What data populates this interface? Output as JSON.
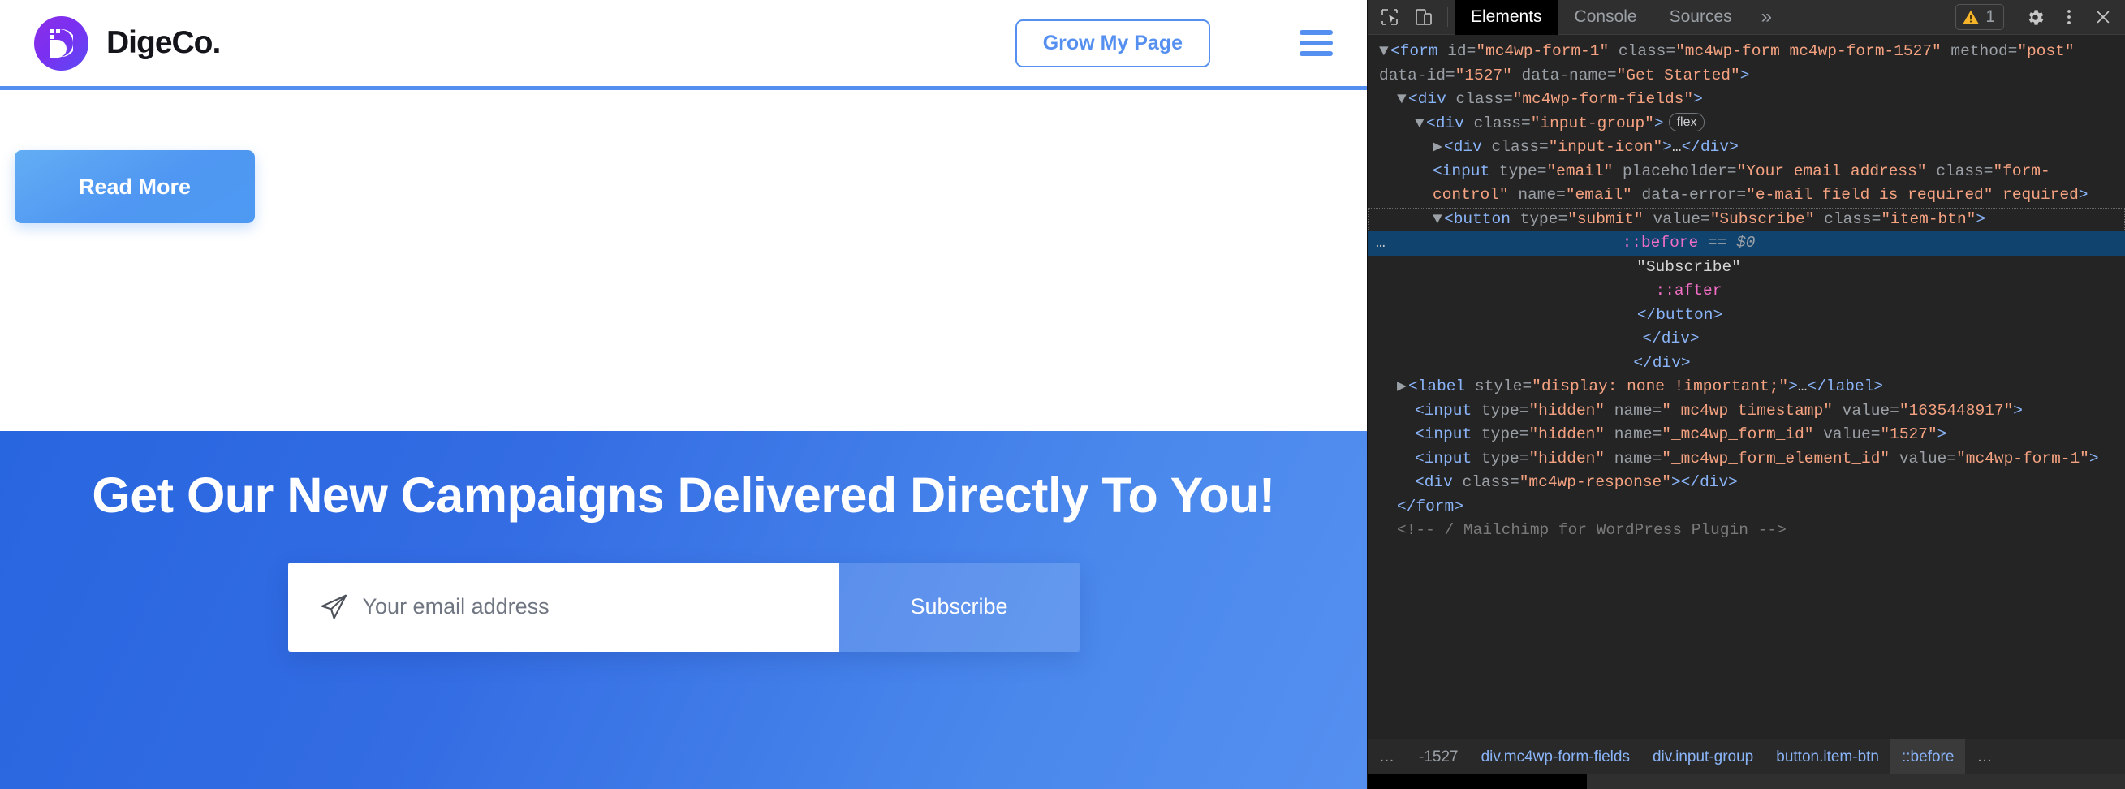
{
  "page": {
    "brand": {
      "name": "DigeCo.",
      "logo_icon": "digeco-d-logo-icon",
      "gradient_from": "#8b2fe8",
      "gradient_to": "#5b4bf5"
    },
    "header": {
      "cta_label": "Grow My Page",
      "menu_icon": "hamburger-menu-icon",
      "accent_color": "#5590f0"
    },
    "content": {
      "read_more_label": "Read More"
    },
    "cta_section": {
      "title": "Get Our New Campaigns Delivered Directly To You!",
      "email_placeholder": "Your email address",
      "email_value": "",
      "submit_label": "Subscribe",
      "input_icon": "paper-plane-icon",
      "background_from": "#2866df",
      "background_to": "#5590f0"
    }
  },
  "devtools": {
    "toolbar": {
      "inspect_icon": "inspect-element-icon",
      "device_icon": "device-toolbar-icon",
      "tabs": [
        {
          "label": "Elements",
          "active": true
        },
        {
          "label": "Console",
          "active": false
        },
        {
          "label": "Sources",
          "active": false
        }
      ],
      "more_tabs_label": "»",
      "warning_count": "1",
      "warning_icon": "warning-triangle-icon",
      "settings_icon": "gear-icon",
      "kebab_icon": "more-options-icon",
      "close_icon": "close-icon"
    },
    "dom_lines": [
      {
        "indent": 0,
        "marker": "▼",
        "parts": [
          {
            "t": "tag",
            "v": "<form "
          },
          {
            "t": "attr",
            "v": "id"
          },
          {
            "t": "eq",
            "v": "="
          },
          {
            "t": "val",
            "v": "\"mc4wp-form-1\""
          },
          {
            "t": "attr",
            "v": " class"
          },
          {
            "t": "eq",
            "v": "="
          },
          {
            "t": "val",
            "v": "\"mc4wp-form mc4wp-form-1527\""
          },
          {
            "t": "attr",
            "v": " method"
          },
          {
            "t": "eq",
            "v": "="
          },
          {
            "t": "val",
            "v": "\"post\""
          },
          {
            "t": "attr",
            "v": " data-id"
          },
          {
            "t": "eq",
            "v": "="
          },
          {
            "t": "val",
            "v": "\"1527\""
          },
          {
            "t": "attr",
            "v": " data-name"
          },
          {
            "t": "eq",
            "v": "="
          },
          {
            "t": "val",
            "v": "\"Get Started\""
          },
          {
            "t": "tag",
            "v": ">"
          }
        ]
      },
      {
        "indent": 1,
        "marker": "▼",
        "parts": [
          {
            "t": "tag",
            "v": "<div "
          },
          {
            "t": "attr",
            "v": "class"
          },
          {
            "t": "eq",
            "v": "="
          },
          {
            "t": "val",
            "v": "\"mc4wp-form-fields\""
          },
          {
            "t": "tag",
            "v": ">"
          }
        ]
      },
      {
        "indent": 2,
        "marker": "▼",
        "badge": "flex",
        "parts": [
          {
            "t": "tag",
            "v": "<div "
          },
          {
            "t": "attr",
            "v": "class"
          },
          {
            "t": "eq",
            "v": "="
          },
          {
            "t": "val",
            "v": "\"input-group\""
          },
          {
            "t": "tag",
            "v": ">"
          }
        ]
      },
      {
        "indent": 3,
        "marker": "▶",
        "parts": [
          {
            "t": "tag",
            "v": "<div "
          },
          {
            "t": "attr",
            "v": "class"
          },
          {
            "t": "eq",
            "v": "="
          },
          {
            "t": "val",
            "v": "\"input-icon\""
          },
          {
            "t": "tag",
            "v": ">"
          },
          {
            "t": "txt",
            "v": "…"
          },
          {
            "t": "tag",
            "v": "</div>"
          }
        ]
      },
      {
        "indent": 3,
        "marker": "",
        "parts": [
          {
            "t": "tag",
            "v": "<input "
          },
          {
            "t": "attr",
            "v": "type"
          },
          {
            "t": "eq",
            "v": "="
          },
          {
            "t": "val",
            "v": "\"email\""
          },
          {
            "t": "attr",
            "v": " placeholder"
          },
          {
            "t": "eq",
            "v": "="
          },
          {
            "t": "val",
            "v": "\"Your email address\""
          },
          {
            "t": "attr",
            "v": " class"
          },
          {
            "t": "eq",
            "v": "="
          },
          {
            "t": "val",
            "v": "\"form-control\""
          },
          {
            "t": "attr",
            "v": " name"
          },
          {
            "t": "eq",
            "v": "="
          },
          {
            "t": "val",
            "v": "\"email\""
          },
          {
            "t": "attr",
            "v": " data-error"
          },
          {
            "t": "eq",
            "v": "="
          },
          {
            "t": "val",
            "v": "\"e-mail field is required\""
          },
          {
            "t": "val",
            "v": " required"
          },
          {
            "t": "tag",
            "v": ">"
          }
        ]
      },
      {
        "indent": 3,
        "marker": "▼",
        "dashed": true,
        "parts": [
          {
            "t": "tag",
            "v": "<button "
          },
          {
            "t": "attr",
            "v": "type"
          },
          {
            "t": "eq",
            "v": "="
          },
          {
            "t": "val",
            "v": "\"submit\""
          },
          {
            "t": "attr",
            "v": " value"
          },
          {
            "t": "eq",
            "v": "="
          },
          {
            "t": "val",
            "v": "\"Subscribe\""
          },
          {
            "t": "attr",
            "v": " class"
          },
          {
            "t": "eq",
            "v": "="
          },
          {
            "t": "val",
            "v": "\"item-btn\""
          },
          {
            "t": "tag",
            "v": ">"
          }
        ]
      },
      {
        "indent": 4,
        "marker": "",
        "selected": true,
        "center": true,
        "parts": [
          {
            "t": "pseudo",
            "v": "::before"
          },
          {
            "t": "eq",
            "v": " == "
          },
          {
            "t": "dollar",
            "v": "$0"
          }
        ]
      },
      {
        "indent": 4,
        "marker": "",
        "center": true,
        "parts": [
          {
            "t": "txt",
            "v": "\"Subscribe\""
          }
        ]
      },
      {
        "indent": 4,
        "marker": "",
        "center": true,
        "parts": [
          {
            "t": "pseudo",
            "v": "::after"
          }
        ]
      },
      {
        "indent": 3,
        "marker": "",
        "center": true,
        "parts": [
          {
            "t": "tag",
            "v": "</button>"
          }
        ]
      },
      {
        "indent": 2,
        "marker": "",
        "center": true,
        "parts": [
          {
            "t": "tag",
            "v": "</div>"
          }
        ]
      },
      {
        "indent": 1,
        "marker": "",
        "center": true,
        "parts": [
          {
            "t": "tag",
            "v": "</div>"
          }
        ]
      },
      {
        "indent": 1,
        "marker": "▶",
        "parts": [
          {
            "t": "tag",
            "v": "<label "
          },
          {
            "t": "attr",
            "v": "style"
          },
          {
            "t": "eq",
            "v": "="
          },
          {
            "t": "val",
            "v": "\"display: none !important;\""
          },
          {
            "t": "tag",
            "v": ">"
          },
          {
            "t": "txt",
            "v": "…"
          },
          {
            "t": "tag",
            "v": "</label>"
          }
        ]
      },
      {
        "indent": 2,
        "marker": "",
        "parts": [
          {
            "t": "tag",
            "v": "<input "
          },
          {
            "t": "attr",
            "v": "type"
          },
          {
            "t": "eq",
            "v": "="
          },
          {
            "t": "val",
            "v": "\"hidden\""
          },
          {
            "t": "attr",
            "v": " name"
          },
          {
            "t": "eq",
            "v": "="
          },
          {
            "t": "val",
            "v": "\"_mc4wp_timestamp\""
          },
          {
            "t": "attr",
            "v": " value"
          },
          {
            "t": "eq",
            "v": "="
          },
          {
            "t": "val",
            "v": "\"1635448917\""
          },
          {
            "t": "tag",
            "v": ">"
          }
        ]
      },
      {
        "indent": 2,
        "marker": "",
        "parts": [
          {
            "t": "tag",
            "v": "<input "
          },
          {
            "t": "attr",
            "v": "type"
          },
          {
            "t": "eq",
            "v": "="
          },
          {
            "t": "val",
            "v": "\"hidden\""
          },
          {
            "t": "attr",
            "v": " name"
          },
          {
            "t": "eq",
            "v": "="
          },
          {
            "t": "val",
            "v": "\"_mc4wp_form_id\""
          },
          {
            "t": "attr",
            "v": " value"
          },
          {
            "t": "eq",
            "v": "="
          },
          {
            "t": "val",
            "v": "\"1527\""
          },
          {
            "t": "tag",
            "v": ">"
          }
        ]
      },
      {
        "indent": 2,
        "marker": "",
        "parts": [
          {
            "t": "tag",
            "v": "<input "
          },
          {
            "t": "attr",
            "v": "type"
          },
          {
            "t": "eq",
            "v": "="
          },
          {
            "t": "val",
            "v": "\"hidden\""
          },
          {
            "t": "attr",
            "v": " name"
          },
          {
            "t": "eq",
            "v": "="
          },
          {
            "t": "val",
            "v": "\"_mc4wp_form_element_id\""
          },
          {
            "t": "attr",
            "v": " value"
          },
          {
            "t": "eq",
            "v": "="
          },
          {
            "t": "val",
            "v": "\"mc4wp-form-1\""
          },
          {
            "t": "tag",
            "v": ">"
          }
        ]
      },
      {
        "indent": 2,
        "marker": "",
        "parts": [
          {
            "t": "tag",
            "v": "<div "
          },
          {
            "t": "attr",
            "v": "class"
          },
          {
            "t": "eq",
            "v": "="
          },
          {
            "t": "val",
            "v": "\"mc4wp-response\""
          },
          {
            "t": "tag",
            "v": "></div>"
          }
        ]
      },
      {
        "indent": 1,
        "marker": "",
        "parts": [
          {
            "t": "tag",
            "v": "</form>"
          }
        ]
      },
      {
        "indent": 1,
        "marker": "",
        "parts": [
          {
            "t": "cmt",
            "v": "<!-- / Mailchimp for WordPress Plugin -->"
          }
        ]
      }
    ],
    "breadcrumb": [
      {
        "label": "…",
        "kind": "dots"
      },
      {
        "label": "-1527",
        "kind": "faint"
      },
      {
        "label": "div.mc4wp-form-fields",
        "kind": "link"
      },
      {
        "label": "div.input-group",
        "kind": "link"
      },
      {
        "label": "button.item-btn",
        "kind": "link"
      },
      {
        "label": "::before",
        "kind": "sel"
      },
      {
        "label": "…",
        "kind": "dots"
      }
    ]
  }
}
